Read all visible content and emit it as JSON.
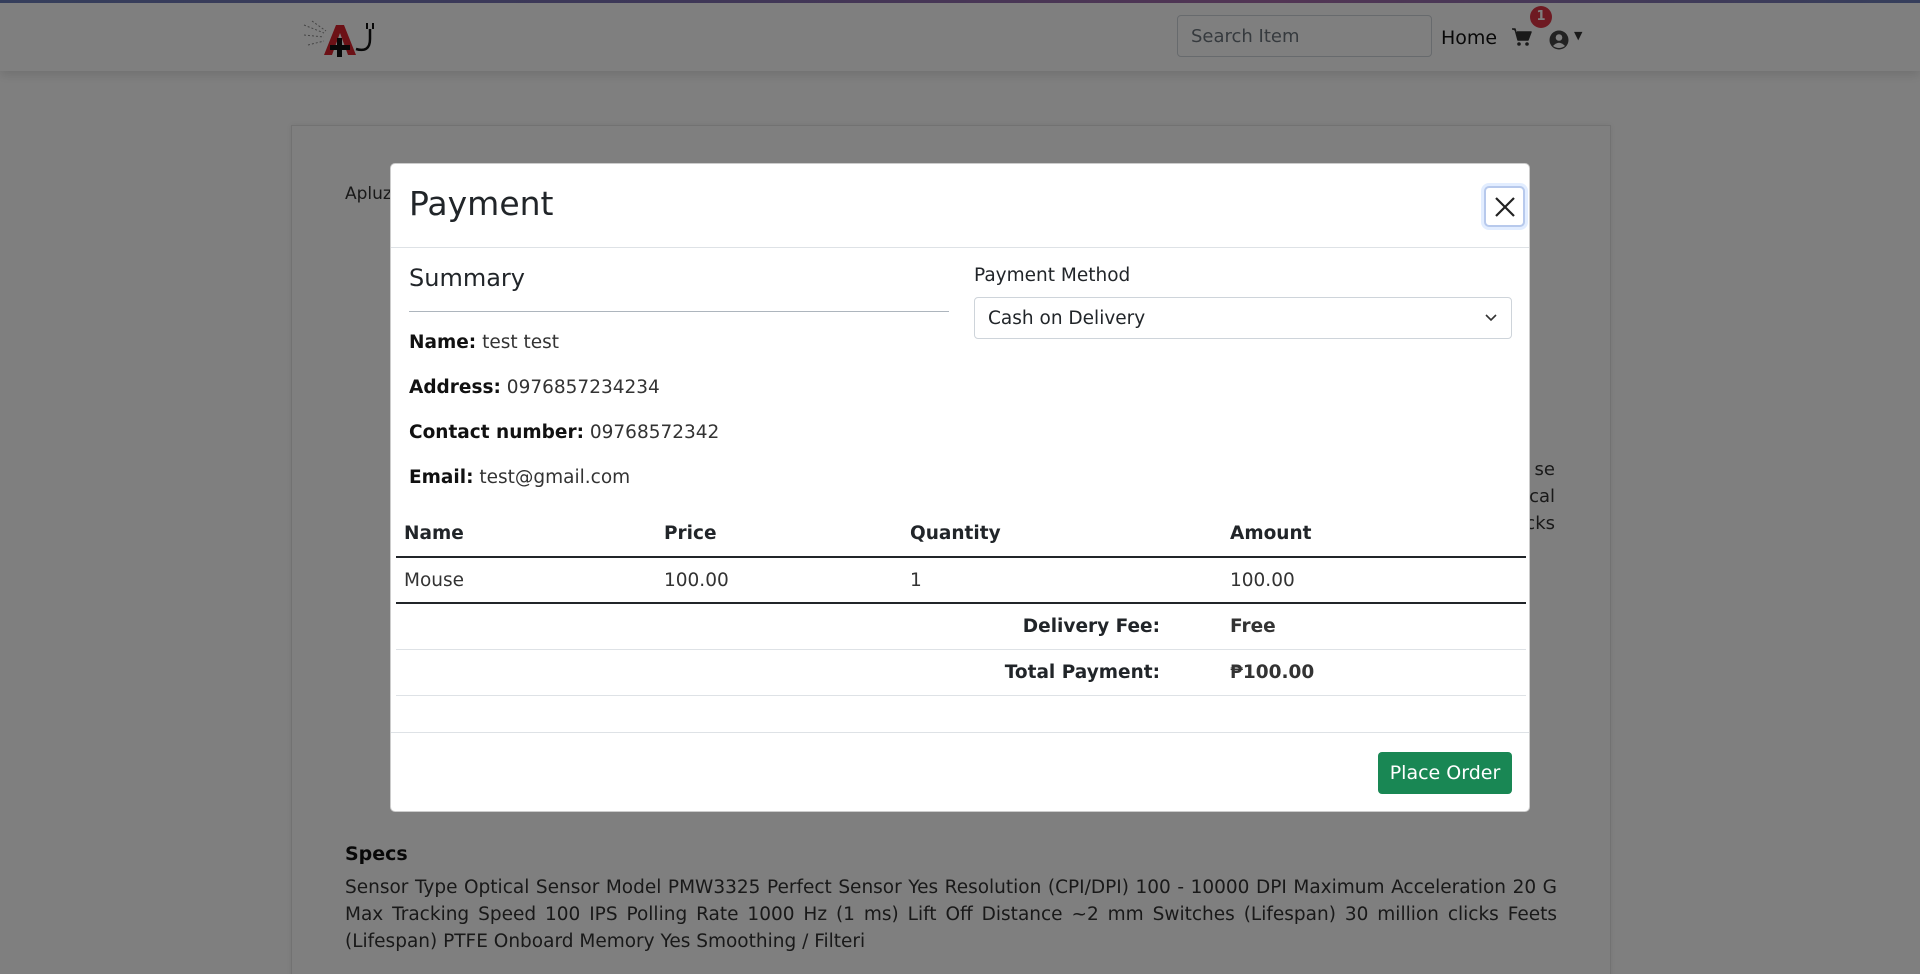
{
  "navbar": {
    "search_placeholder": "Search Item",
    "home_label": "Home",
    "cart_count": "1",
    "logo_icon": "logo-icon",
    "cart_icon": "cart-icon",
    "user_icon": "user-icon"
  },
  "background": {
    "brand_partial": "Apluz",
    "desc_fragments": [
      "se",
      "cal",
      "cks"
    ],
    "specs_title": "Specs",
    "specs_text": "Sensor Type Optical Sensor Model PMW3325 Perfect Sensor Yes Resolution (CPI/DPI) 100 - 10000 DPI Maximum Acceleration 20 G Max Tracking Speed 100 IPS Polling Rate 1000 Hz (1 ms) Lift Off Distance ~2 mm Switches (Lifespan) 30 million clicks Feets (Lifespan) PTFE Onboard Memory Yes Smoothing / Filteri"
  },
  "modal": {
    "title": "Payment",
    "close_icon": "close-icon",
    "summary_title": "Summary",
    "name_label": "Name:",
    "name_value": "test test",
    "address_label": "Address:",
    "address_value": "0976857234234",
    "contact_label": "Contact number:",
    "contact_value": "09768572342",
    "email_label": "Email:",
    "email_value": "test@gmail.com",
    "payment_method_label": "Payment Method",
    "payment_method_value": "Cash on Delivery",
    "table": {
      "headers": [
        "Name",
        "Price",
        "Quantity",
        "Amount"
      ],
      "rows": [
        [
          "Mouse",
          "100.00",
          "1",
          "100.00"
        ]
      ],
      "delivery_label": "Delivery Fee:",
      "delivery_value": "Free",
      "total_label": "Total Payment:",
      "total_value": "₱100.00"
    },
    "place_order_label": "Place Order"
  },
  "colors": {
    "primary_green": "#198754",
    "badge_red": "#dc3545"
  }
}
